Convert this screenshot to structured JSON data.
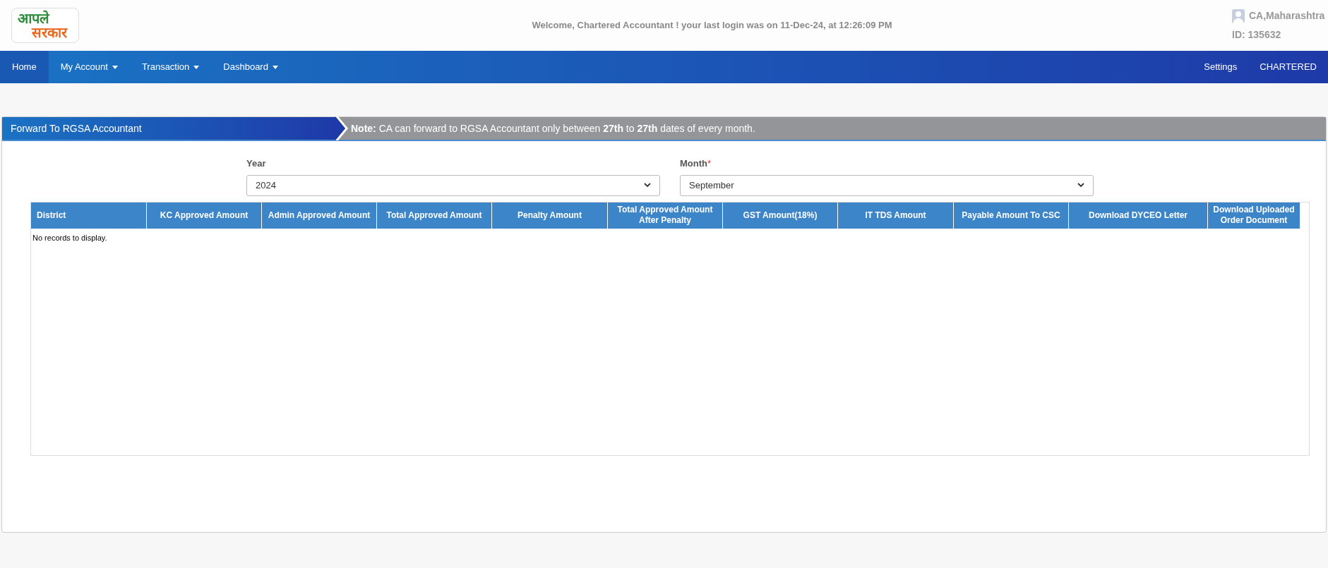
{
  "header": {
    "logo": {
      "line_1": "आपले",
      "line_2": "सरकार"
    },
    "welcome": "Welcome, Chartered Accountant ! your last login was on 11-Dec-24, at 12:26:09 PM",
    "user": {
      "name": "CA,Maharashtra",
      "id": "ID: 135632"
    }
  },
  "nav": {
    "items": [
      {
        "label": "Home",
        "selected": true,
        "dropdown": false
      },
      {
        "label": "My Account",
        "selected": false,
        "dropdown": true
      },
      {
        "label": "Transaction",
        "selected": false,
        "dropdown": true
      },
      {
        "label": "Dashboard",
        "selected": false,
        "dropdown": true
      }
    ],
    "right_items": [
      "Settings",
      "CHARTERED"
    ]
  },
  "panel": {
    "title": "Forward To RGSA Accountant",
    "note": "**Note:** CA can forward to RGSA Accountant only between **27th** to **27th** dates of every month.",
    "fields": [
      {
        "label": "Year",
        "value": "2024"
      },
      {
        "label": "Month",
        "required_mark": "*",
        "value": "September"
      }
    ],
    "table": {
      "columns": [
        "District",
        "KC Approved Amount",
        "Admin Approved Amount",
        "Total Approved Amount",
        "Penalty Amount",
        "Total Approved Amount After Penalty",
        "GST Amount(18%)",
        "IT TDS Amount",
        "Payable Amount To CSC",
        "Download DYCEO Letter",
        "Download Uploaded Order Document"
      ],
      "empty_message": "No records to display."
    }
  }
}
